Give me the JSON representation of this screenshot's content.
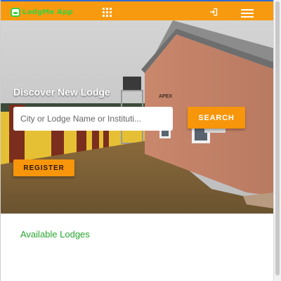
{
  "topbar": {
    "logo_text": "LodgMe App",
    "icons": [
      "apps-grid-icon",
      "login-icon",
      "menu-icon"
    ],
    "background_color": "#f79a0f",
    "accent_color": "#3ad13f"
  },
  "hero": {
    "title": "Discover New Lodge",
    "search": {
      "placeholder": "City or Lodge Name or Instituti...",
      "value": ""
    },
    "search_button_label": "SEARCH",
    "register_button_label": "REGISTER",
    "building_sign": "APEX",
    "button_color": "#f7950b"
  },
  "main": {
    "section_title": "Available Lodges",
    "section_title_color": "#25a52b"
  }
}
